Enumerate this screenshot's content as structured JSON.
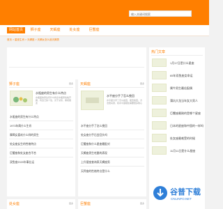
{
  "search": {
    "placeholder": "输入关键词搜索"
  },
  "nav": {
    "items": [
      {
        "label": "网站首页",
        "active": true
      },
      {
        "label": "狮子座",
        "active": false
      },
      {
        "label": "天蝎座",
        "active": false
      },
      {
        "label": "处女座",
        "active": false
      },
      {
        "label": "巨蟹座",
        "active": false
      }
    ]
  },
  "breadcrumb": "首页 > 星座生肖 > 天蝎座 > 天蝎女怎么追天蝎男",
  "sections": {
    "leo": {
      "title": "狮子座",
      "more": "更多",
      "featured": {
        "title": "水瓶座的男生有什么特点",
        "desc": "水瓶座的男生有什么特点水瓶男性格开朗，有自己的个性，善于交际，重视朋友"
      },
      "items": [
        "水瓶座的男生有什么特点",
        "1973年属什么生肖",
        "摩羯女喜欢什么样的男生",
        "处女座女生的性格特点",
        "巨蟹座和处女座合不合",
        "双鱼座2020年事业运"
      ]
    },
    "scorpio": {
      "title": "天蝎座",
      "more": "更多",
      "featured": {
        "title": "水平座分手了怎么挽回",
        "desc": "水平座分手了怎么挽回，能否挽回，方法很关键，和水平座相处需要很多耐心"
      },
      "items": [
        "水平座分手了怎么挽回",
        "处女座分手后会回头吗",
        "巨蟹座和什么星座最配对",
        "天蝎座男生吃醋的表现",
        "上升星座查询表天蝎座男",
        "天秤座的性格特点是什么"
      ]
    },
    "virgo": {
      "title": "处女座",
      "more": "更多"
    },
    "cancer": {
      "title": "巨蟹座",
      "more": "更多"
    }
  },
  "sidebar": {
    "title": "热门文章",
    "items": [
      "1月17日是什么星座",
      "65年双鱼座女命运",
      "属牛男生最佳配偶",
      "蒲坑大龙当年女大男人",
      "巨蟹座最刚的是哪个星座",
      "日本的星座和中国的一样吗",
      "处女座最难受的时候",
      "11月11日是什么星座"
    ]
  },
  "watermark": {
    "line1": "谷普下载",
    "line2": "CNLINFO.NET"
  }
}
